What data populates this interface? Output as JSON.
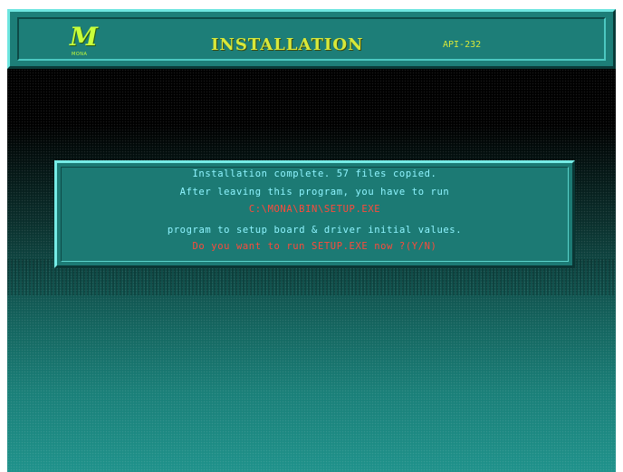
{
  "header": {
    "logo_mark": "M",
    "logo_text": "MONA",
    "title": "INSTALLATION",
    "product": "API-232"
  },
  "dialog": {
    "line1": "Installation complete. 57 files copied.",
    "line2": "After leaving this program, you have to run",
    "path": "C:\\MONA\\BIN\\SETUP.EXE",
    "line4": "program to setup board & driver initial values.",
    "prompt": "Do you want to run SETUP.EXE now ?(Y/N)"
  },
  "colors": {
    "header_bg": "#1d7e78",
    "title": "#d8e83a",
    "info_text": "#8ff4ff",
    "warn_text": "#ff4a3a",
    "dialog_bg": "#1c7a74"
  }
}
